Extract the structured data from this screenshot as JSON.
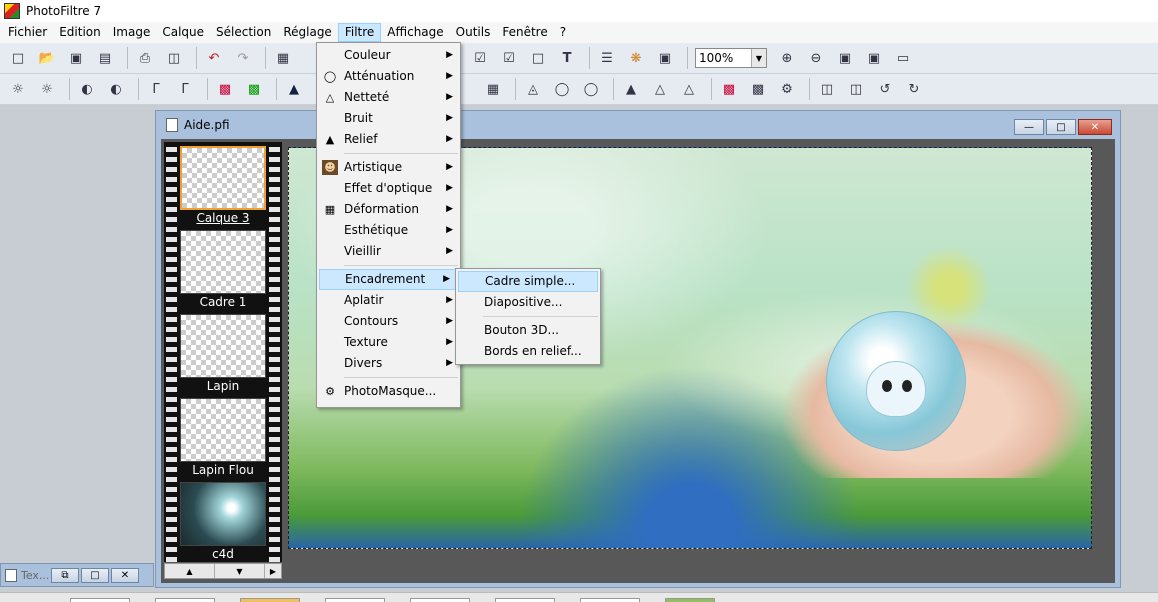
{
  "app": {
    "title": "PhotoFiltre 7"
  },
  "menubar": {
    "items": [
      "Fichier",
      "Edition",
      "Image",
      "Calque",
      "Sélection",
      "Réglage",
      "Filtre",
      "Affichage",
      "Outils",
      "Fenêtre",
      "?"
    ],
    "active_index": 6
  },
  "toolbar": {
    "zoom_value": "100%"
  },
  "document": {
    "title": "Aide.pfi",
    "layers": [
      {
        "label": "Calque 3",
        "selected": true
      },
      {
        "label": "Cadre 1",
        "selected": false
      },
      {
        "label": "Lapin",
        "selected": false
      },
      {
        "label": "Lapin Flou",
        "selected": false
      },
      {
        "label": "c4d",
        "selected": false
      }
    ]
  },
  "filtre_menu": {
    "items": [
      {
        "label": "Couleur",
        "icon": "none",
        "submenu": true
      },
      {
        "label": "Atténuation",
        "icon": "drop-icon",
        "submenu": true
      },
      {
        "label": "Netteté",
        "icon": "triangle-icon",
        "submenu": true
      },
      {
        "label": "Bruit",
        "icon": "none",
        "submenu": true
      },
      {
        "label": "Relief",
        "icon": "mountain-icon",
        "submenu": true
      },
      {
        "label": "Artistique",
        "icon": "portrait-icon",
        "submenu": true
      },
      {
        "label": "Effet d'optique",
        "icon": "none",
        "submenu": true
      },
      {
        "label": "Déformation",
        "icon": "grid-icon",
        "submenu": true
      },
      {
        "label": "Esthétique",
        "icon": "none",
        "submenu": true
      },
      {
        "label": "Vieillir",
        "icon": "none",
        "submenu": true
      },
      {
        "label": "Encadrement",
        "icon": "none",
        "submenu": true,
        "highlighted": true
      },
      {
        "label": "Aplatir",
        "icon": "none",
        "submenu": true
      },
      {
        "label": "Contours",
        "icon": "none",
        "submenu": true
      },
      {
        "label": "Texture",
        "icon": "none",
        "submenu": true
      },
      {
        "label": "Divers",
        "icon": "none",
        "submenu": true
      },
      {
        "label": "PhotoMasque...",
        "icon": "photomask-icon",
        "submenu": false
      }
    ]
  },
  "encadrement_submenu": {
    "items": [
      {
        "label": "Cadre simple...",
        "highlighted": true
      },
      {
        "label": "Diapositive..."
      },
      {
        "label": "Bouton 3D..."
      },
      {
        "label": "Bords en relief..."
      }
    ]
  },
  "bottom_window": {
    "title": "Tex..."
  }
}
